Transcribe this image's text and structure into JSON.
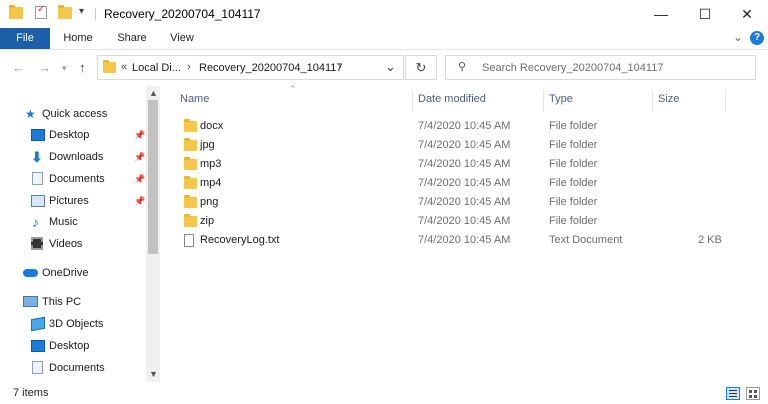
{
  "window": {
    "title": "Recovery_20200704_104117",
    "minimize": "—",
    "maximize": "☐",
    "close": "✕"
  },
  "ribbon": {
    "tabs": [
      "File",
      "Home",
      "Share",
      "View"
    ],
    "expand": "⌄",
    "help": "?"
  },
  "address": {
    "crumb_prefix": "«",
    "crumbs": [
      "Local Di...",
      "Recovery_20200704_104117"
    ],
    "separator": "›",
    "dropdown": "⌄",
    "refresh": "↻"
  },
  "search": {
    "placeholder": "Search Recovery_20200704_104117"
  },
  "nav": {
    "quick_access": "Quick access",
    "items": [
      {
        "label": "Desktop",
        "icon": "desktop-icon",
        "pinned": true
      },
      {
        "label": "Downloads",
        "icon": "download-icon",
        "pinned": true
      },
      {
        "label": "Documents",
        "icon": "documents-icon",
        "pinned": true
      },
      {
        "label": "Pictures",
        "icon": "pictures-icon",
        "pinned": true
      },
      {
        "label": "Music",
        "icon": "music-icon",
        "pinned": false
      },
      {
        "label": "Videos",
        "icon": "videos-icon",
        "pinned": false
      }
    ],
    "onedrive": "OneDrive",
    "thispc": "This PC",
    "pc_items": [
      {
        "label": "3D Objects",
        "icon": "3d-objects-icon"
      },
      {
        "label": "Desktop",
        "icon": "desktop-icon"
      },
      {
        "label": "Documents",
        "icon": "documents-icon"
      }
    ]
  },
  "columns": {
    "name": "Name",
    "date": "Date modified",
    "type": "Type",
    "size": "Size"
  },
  "files": [
    {
      "name": "docx",
      "date": "7/4/2020 10:45 AM",
      "type": "File folder",
      "size": "",
      "kind": "folder"
    },
    {
      "name": "jpg",
      "date": "7/4/2020 10:45 AM",
      "type": "File folder",
      "size": "",
      "kind": "folder"
    },
    {
      "name": "mp3",
      "date": "7/4/2020 10:45 AM",
      "type": "File folder",
      "size": "",
      "kind": "folder"
    },
    {
      "name": "mp4",
      "date": "7/4/2020 10:45 AM",
      "type": "File folder",
      "size": "",
      "kind": "folder"
    },
    {
      "name": "png",
      "date": "7/4/2020 10:45 AM",
      "type": "File folder",
      "size": "",
      "kind": "folder"
    },
    {
      "name": "zip",
      "date": "7/4/2020 10:45 AM",
      "type": "File folder",
      "size": "",
      "kind": "folder"
    },
    {
      "name": "RecoveryLog.txt",
      "date": "7/4/2020 10:45 AM",
      "type": "Text Document",
      "size": "2 KB",
      "kind": "text"
    }
  ],
  "status": {
    "items": "7 items"
  },
  "colors": {
    "file_tab": "#1c5fa8",
    "folder": "#f4c64a",
    "header_text": "#4d5d7a"
  }
}
